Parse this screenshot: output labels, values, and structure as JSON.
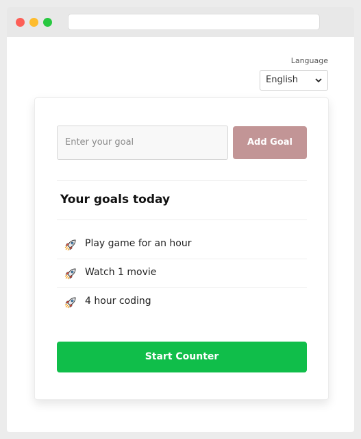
{
  "language": {
    "label": "Language",
    "selected": "English"
  },
  "goal_form": {
    "input_placeholder": "Enter your goal",
    "add_button": "Add Goal"
  },
  "goals": {
    "title": "Your goals today",
    "items": [
      {
        "icon": "rocket-icon",
        "text": "Play game for an hour"
      },
      {
        "icon": "rocket-icon",
        "text": "Watch 1 movie"
      },
      {
        "icon": "rocket-icon",
        "text": "4 hour coding"
      }
    ]
  },
  "start_button": "Start Counter",
  "colors": {
    "add_button_bg": "#c29596",
    "start_button_bg": "#10be4a"
  }
}
